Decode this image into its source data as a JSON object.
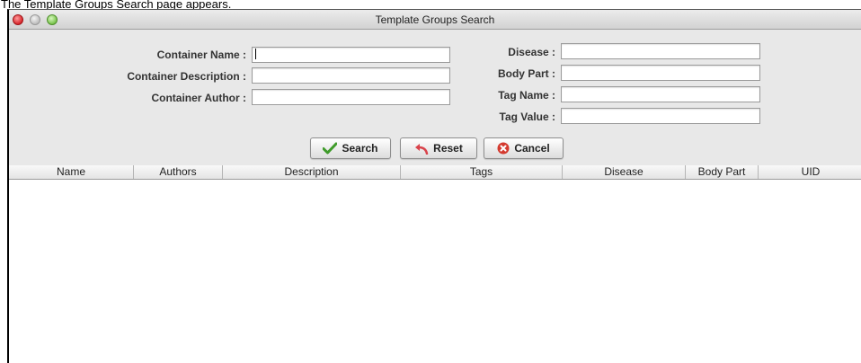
{
  "caption": "The Template Groups Search page appears.",
  "window": {
    "title": "Template Groups Search"
  },
  "form": {
    "container_name": {
      "label": "Container Name :",
      "value": ""
    },
    "container_description": {
      "label": "Container Description :",
      "value": ""
    },
    "container_author": {
      "label": "Container Author :",
      "value": ""
    },
    "disease": {
      "label": "Disease :",
      "value": ""
    },
    "body_part": {
      "label": "Body Part :",
      "value": ""
    },
    "tag_name": {
      "label": "Tag Name :",
      "value": ""
    },
    "tag_value": {
      "label": "Tag Value :",
      "value": ""
    }
  },
  "buttons": {
    "search": {
      "label": "Search",
      "icon": "checkmark-icon",
      "color": "#3f9b2a"
    },
    "reset": {
      "label": "Reset",
      "icon": "undo-arrow-icon",
      "color": "#d9434b"
    },
    "cancel": {
      "label": "Cancel",
      "icon": "cancel-circle-icon",
      "color": "#d43a2f"
    }
  },
  "table": {
    "columns": [
      "Name",
      "Authors",
      "Description",
      "Tags",
      "Disease",
      "Body Part",
      "UID"
    ],
    "rows": []
  }
}
